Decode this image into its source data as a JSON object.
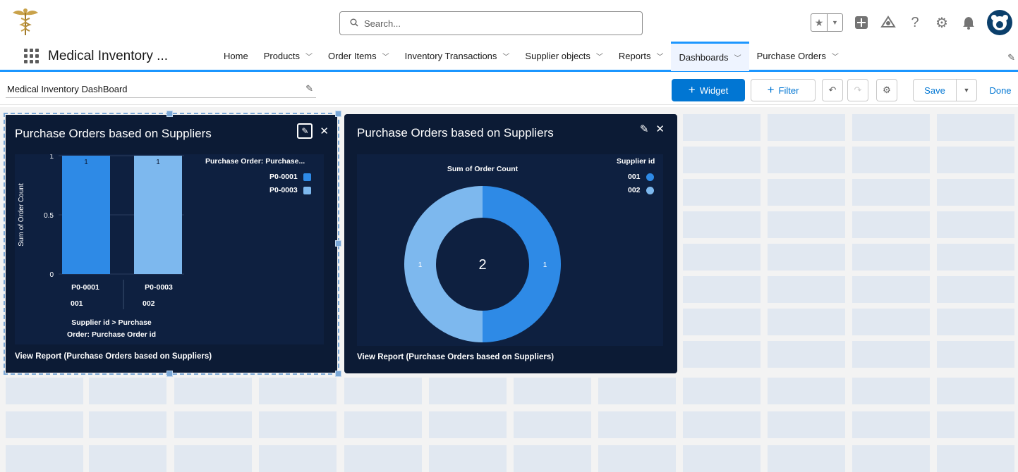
{
  "header": {
    "search_placeholder": "Search...",
    "icons": [
      "logo-caduceus-icon",
      "search-icon",
      "favorites-star-icon",
      "global-add-icon",
      "help-trailhead-icon",
      "help-icon",
      "setup-gear-icon",
      "notifications-bell-icon",
      "avatar-icon"
    ]
  },
  "nav": {
    "app_name": "Medical Inventory ...",
    "tabs": [
      {
        "label": "Home",
        "has_menu": false
      },
      {
        "label": "Products",
        "has_menu": true
      },
      {
        "label": "Order Items",
        "has_menu": true
      },
      {
        "label": "Inventory Transactions",
        "has_menu": true
      },
      {
        "label": "Supplier objects",
        "has_menu": true
      },
      {
        "label": "Reports",
        "has_menu": true
      },
      {
        "label": "Dashboards",
        "has_menu": true,
        "active": true
      },
      {
        "label": "Purchase Orders",
        "has_menu": true
      }
    ]
  },
  "toolbar": {
    "dashboard_name": "Medical Inventory DashBoard",
    "widget_label": "Widget",
    "filter_label": "Filter",
    "save_label": "Save",
    "done_label": "Done"
  },
  "widgets": [
    {
      "title": "Purchase Orders based on Suppliers",
      "footer": "View Report (Purchase Orders based on Suppliers)",
      "legend_title": "Purchase Order: Purchase...",
      "x_group_label_line1": "Supplier id  >  Purchase",
      "x_group_label_line2": "Order: Purchase Order id"
    },
    {
      "title": "Purchase Orders based on Suppliers",
      "footer": "View Report (Purchase Orders based on Suppliers)",
      "legend_title": "Supplier id"
    }
  ],
  "chart_data": [
    {
      "type": "bar",
      "title": "Purchase Orders based on Suppliers",
      "ylabel": "Sum of Order Count",
      "ylim": [
        0,
        1
      ],
      "yticks": [
        "0",
        "0.5",
        "1"
      ],
      "categories": [
        {
          "label": "P0-0001",
          "group": "001"
        },
        {
          "label": "P0-0003",
          "group": "002"
        }
      ],
      "values": [
        1,
        1
      ],
      "data_labels": [
        "1",
        "1"
      ],
      "legend": [
        "P0-0001",
        "P0-0003"
      ],
      "colors": [
        "#2e8ae6",
        "#7db8ee"
      ],
      "legend_position": "top-right",
      "grid": true
    },
    {
      "type": "pie",
      "title": "Purchase Orders based on Suppliers",
      "subtitle": "Sum of Order Count",
      "center_total": "2",
      "slices": [
        {
          "label": "001",
          "value": 1,
          "color": "#2e8ae6"
        },
        {
          "label": "002",
          "value": 1,
          "color": "#7db8ee"
        }
      ],
      "data_labels": [
        "1",
        "1"
      ],
      "legend_position": "top-right"
    }
  ]
}
